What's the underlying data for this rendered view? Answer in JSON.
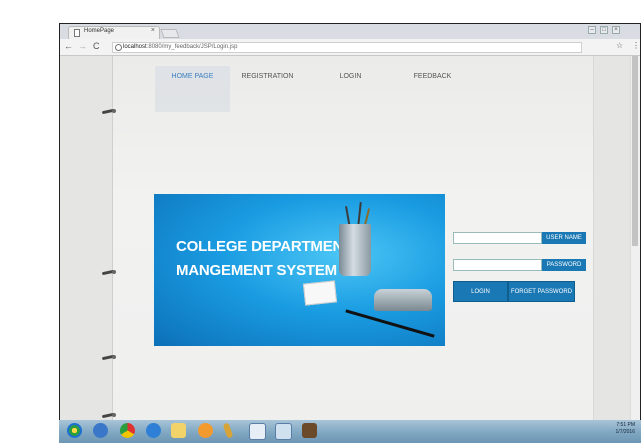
{
  "browser": {
    "tab_title": "HomePage",
    "tab_close": "×",
    "url_host": "localhost",
    "url_path": ":8080/my_feedback/JSP/Login.jsp",
    "nav_back": "←",
    "nav_forward": "→",
    "nav_reload": "C",
    "star": "☆",
    "menu": "⋮"
  },
  "nav": {
    "items": [
      {
        "label": "HOME PAGE"
      },
      {
        "label": "REGISTRATION"
      },
      {
        "label": "LOGIN"
      },
      {
        "label": "FEEDBACK"
      }
    ]
  },
  "banner": {
    "line1": "COLLEGE DEPARTMENT",
    "line2": "MANGEMENT SYSTEM"
  },
  "login": {
    "username_value": "",
    "username_label": "USER NAME",
    "password_value": "",
    "password_label": "PASSWORD",
    "login_button": "LOGIN",
    "forget_button": "FORGET PASSWORD"
  },
  "taskbar": {
    "time": "7:51 PM",
    "date": "1/7/2016"
  },
  "colors": {
    "accent": "#1a79b5",
    "active_nav": "#3a7fc0",
    "banner": "#1a9ce2"
  }
}
